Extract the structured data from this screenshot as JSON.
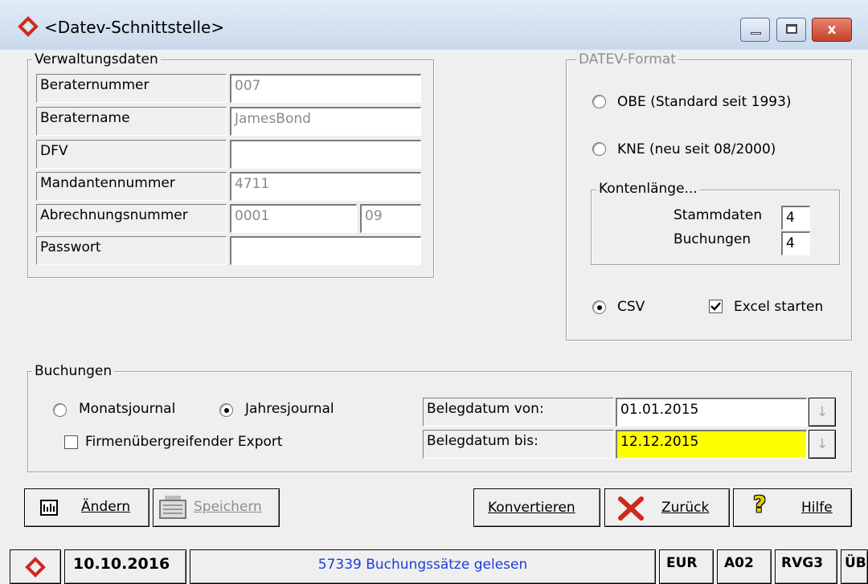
{
  "window": {
    "title": "<Datev-Schnittstelle>",
    "close_glyph": "x"
  },
  "verwaltung": {
    "legend": "Verwaltungsdaten",
    "rows": [
      {
        "label": "Beraternummer",
        "value": "007"
      },
      {
        "label": "Beratername",
        "value": "JamesBond"
      },
      {
        "label": "DFV",
        "value": ""
      },
      {
        "label": "Mandantennummer",
        "value": "4711"
      },
      {
        "label": "Abrechnungsnummer",
        "value": "0001",
        "value2": "09"
      },
      {
        "label": "Passwort",
        "value": ""
      }
    ]
  },
  "format": {
    "legend": "DATEV-Format",
    "obe": "OBE (Standard seit 1993)",
    "kne": "KNE (neu seit 08/2000)",
    "konten_legend": "Kontenlänge...",
    "stammdaten_label": "Stammdaten",
    "stammdaten_value": "4",
    "buchungen_label": "Buchungen",
    "buchungen_value": "4",
    "csv": "CSV",
    "excel": "Excel starten"
  },
  "buchungen": {
    "legend": "Buchungen",
    "monats": "Monatsjournal",
    "jahres": "Jahresjournal",
    "firmen": "Firmenübergreifender Export",
    "von_label": "Belegdatum von:",
    "von_value": "01.01.2015",
    "bis_label": "Belegdatum bis:",
    "bis_value": "12.12.2015"
  },
  "toolbar": {
    "aendern": "Ändern",
    "speichern": "Speichern",
    "konvertieren": "Konvertieren",
    "zurueck": "Zurück",
    "hilfe": "Hilfe"
  },
  "statusbar": {
    "date": "10.10.2016",
    "message": "57339 Buchungssätze gelesen",
    "currency": "EUR",
    "code1": "A02",
    "code2": "RVG3",
    "code3": "ÜB"
  },
  "colors": {
    "highlight": "#ffff00",
    "message": "#1c3fd6",
    "close": "#c2432a",
    "logo": "#d0281c"
  },
  "icons": {
    "app": "datev-logo-icon",
    "zurueck": "red-x-icon",
    "hilfe": "question-icon",
    "aendern": "edit-grid-icon",
    "speichern": "keyboard-icon"
  }
}
